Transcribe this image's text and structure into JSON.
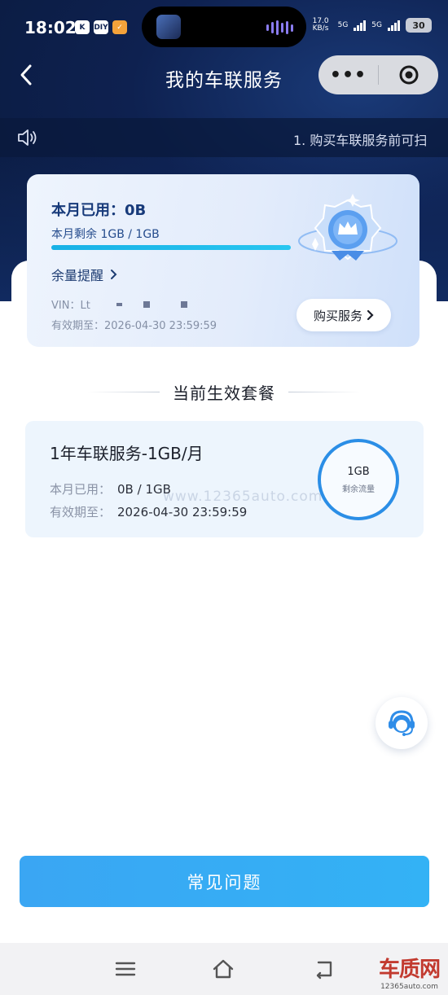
{
  "status_bar": {
    "time": "18:02",
    "badge_k": "K",
    "badge_diy": "DIY",
    "network_speed": "17.0 KB/s",
    "signal_a": "5G",
    "signal_b": "5G",
    "battery": "30"
  },
  "header": {
    "title": "我的车联服务",
    "more_label": "•••"
  },
  "notice": {
    "text": "1. 购买车联服务前可扫"
  },
  "usage_card": {
    "used_label": "本月已用：0B",
    "remaining_label": "本月剩余 1GB / 1GB",
    "remaining_fraction": 1.0,
    "reminder_label": "余量提醒",
    "vin_label": "VIN：Lt",
    "expire_label": "有效期至：2026-04-30 23:59:59",
    "buy_label": "购买服务"
  },
  "section": {
    "title": "当前生效套餐"
  },
  "plan": {
    "name": "1年车联服务-1GB/月",
    "used_key": "本月已用：",
    "used_value": "0B / 1GB",
    "expire_key": "有效期至：",
    "expire_value": "2026-04-30 23:59:59",
    "ring_value": "1GB",
    "ring_label": "剩余流量"
  },
  "watermark": "www.12365auto.com",
  "faq": {
    "label": "常见问题"
  },
  "site_mark": {
    "name": "车质网",
    "domain": "12365auto.com"
  },
  "colors": {
    "hero": "#0e2150",
    "accent": "#2b8ee6",
    "faq_button": "#3aa6f3",
    "progress": "#17b1e6"
  }
}
